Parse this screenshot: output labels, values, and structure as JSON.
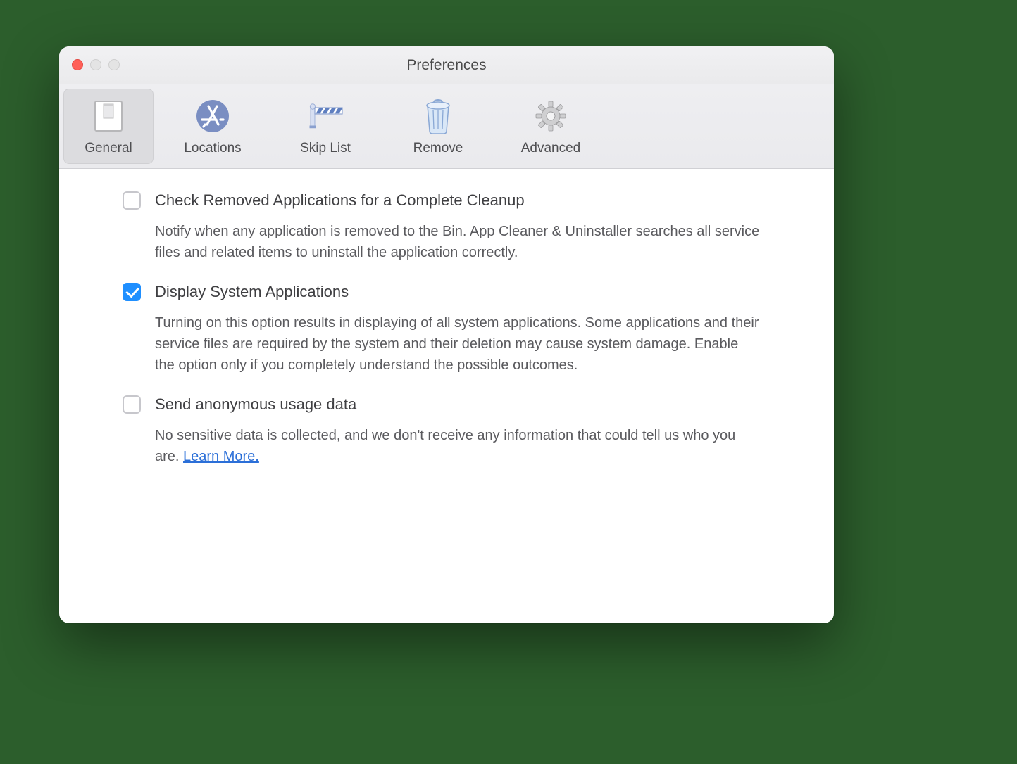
{
  "window": {
    "title": "Preferences"
  },
  "toolbar": {
    "tabs": [
      {
        "label": "General",
        "selected": true
      },
      {
        "label": "Locations",
        "selected": false
      },
      {
        "label": "Skip List",
        "selected": false
      },
      {
        "label": "Remove",
        "selected": false
      },
      {
        "label": "Advanced",
        "selected": false
      }
    ]
  },
  "options": [
    {
      "checked": false,
      "title": "Check Removed Applications for a Complete Cleanup",
      "description": "Notify when any application is removed to the Bin. App Cleaner & Uninstaller searches all service files and related items to uninstall the application correctly."
    },
    {
      "checked": true,
      "title": "Display System Applications",
      "description": "Turning on this option results in displaying of all system applications. Some applications and their service files are required by the system and their deletion may cause system damage. Enable the option only if you completely understand the possible outcomes."
    },
    {
      "checked": false,
      "title": "Send anonymous usage data",
      "description": "No sensitive data is collected, and we don't receive any information that could tell us who you are.   ",
      "link_text": "Learn More."
    }
  ]
}
